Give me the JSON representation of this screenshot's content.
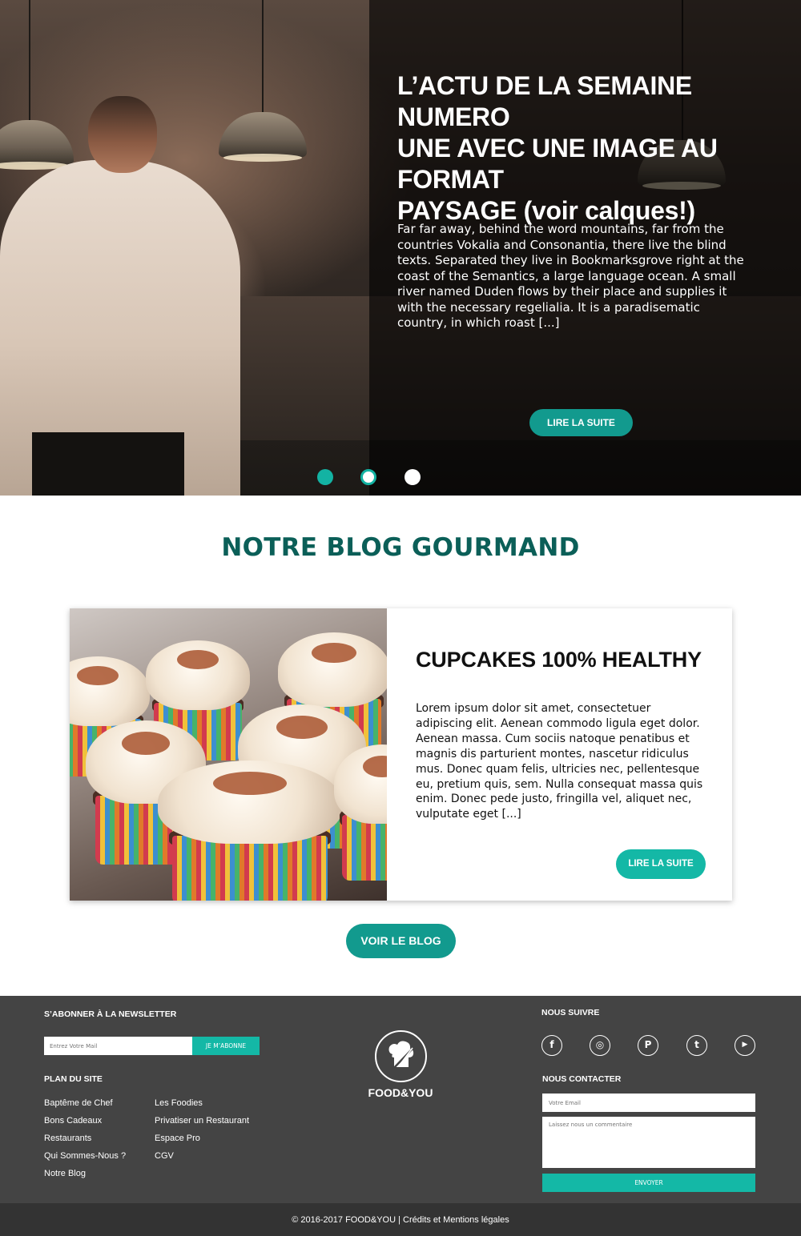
{
  "hero": {
    "title": "L’ACTU DE LA SEMAINE NUMERO\nUNE AVEC UNE IMAGE AU FORMAT\nPAYSAGE (voir calques!)",
    "text": "Far far away, behind the word mountains, far from the\ncountries Vokalia and Consonantia, there live the blind\ntexts. Separated they live in Bookmarksgrove right at the\ncoast of the Semantics, a large language ocean. A small\nriver named Duden flows by their place and supplies it\nwith the necessary regelialia. It is a paradisematic\ncountry, in which roast [...]",
    "button": "LIRE LA SUITE",
    "slides_total": 3,
    "active_slide": 2
  },
  "blog": {
    "section_title": "NOTRE BLOG GOURMAND",
    "card_title": "CUPCAKES 100% HEALTHY",
    "card_text": "Lorem ipsum dolor sit amet, consectetuer\nadipiscing elit. Aenean commodo ligula eget dolor.\nAenean massa. Cum sociis natoque penatibus et\nmagnis dis parturient montes, nascetur ridiculus\nmus. Donec quam felis, ultricies nec, pellentesque\neu, pretium quis, sem. Nulla consequat massa quis\nenim. Donec pede justo, fringilla vel, aliquet nec,\nvulputate eget [...]",
    "card_button": "LIRE LA SUITE",
    "view_blog_button": "VOIR LE BLOG"
  },
  "footer": {
    "newsletter_heading": "S’ABONNER À LA NEWSLETTER",
    "newsletter_placeholder": "Entrez Votre Mail",
    "newsletter_button": "JE M’ABONNE",
    "sitemap_heading": "PLAN DU SITE",
    "sitemap_col1": [
      "Baptême de Chef",
      "Bons Cadeaux",
      "Restaurants",
      "Qui Sommes-Nous ?",
      "Notre Blog"
    ],
    "sitemap_col2": [
      "Les Foodies",
      "Privatiser un Restaurant",
      "Espace Pro",
      "CGV"
    ],
    "logo_text": "FOOD&YOU",
    "follow_heading": "NOUS SUIVRE",
    "social_icons": [
      "facebook-icon",
      "instagram-icon",
      "pinterest-icon",
      "twitter-icon",
      "youtube-icon"
    ],
    "social_glyphs": [
      "f",
      "◎",
      "P",
      "t",
      "▶"
    ],
    "contact_heading": "NOUS CONTACTER",
    "email_placeholder": "Votre Email",
    "comment_placeholder": "Laissez nous un commentaire",
    "send_button": "ENVOYER",
    "copyright": "© 2016-2017 FOOD&YOU",
    "legal_link": "Crédits et Mentions légales"
  },
  "colors": {
    "accent": "#14b8a6",
    "accent_dark": "#129a8e",
    "title_teal": "#0b5f58",
    "footer_bg": "#444444",
    "copyright_bg": "#333333"
  }
}
